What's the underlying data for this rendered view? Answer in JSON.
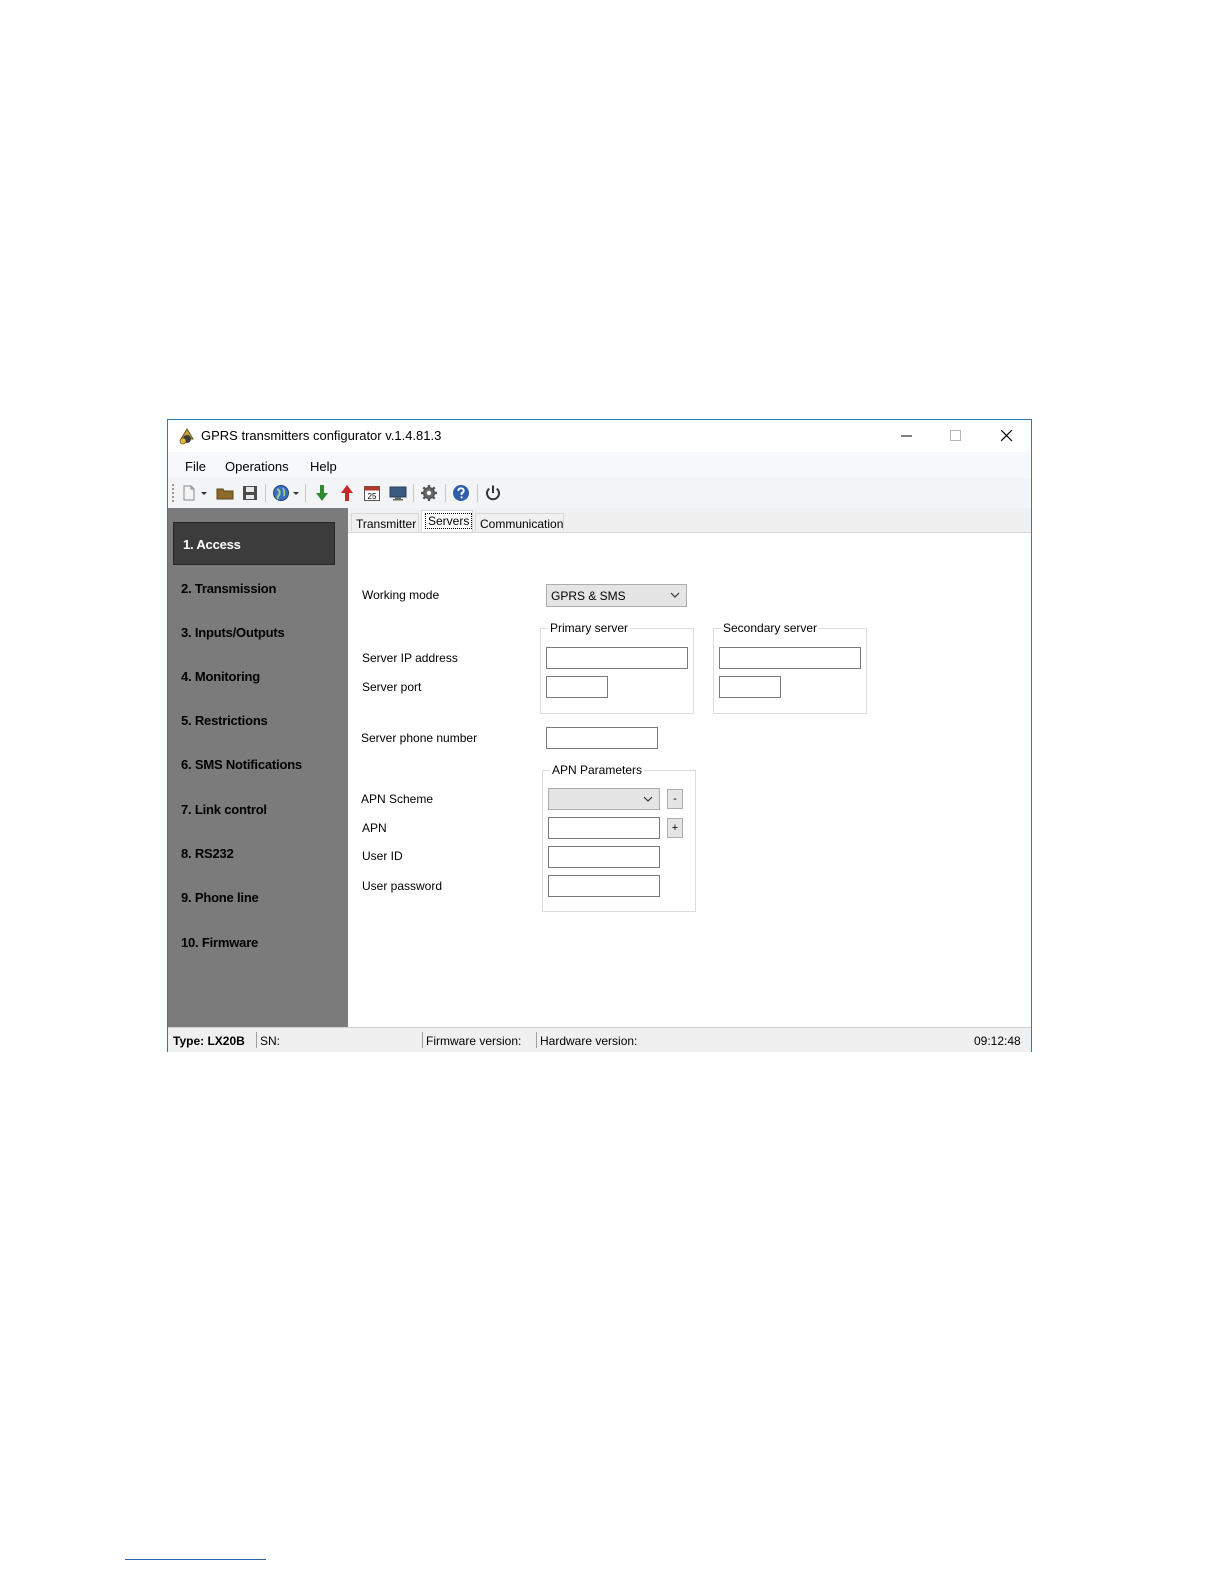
{
  "window": {
    "title": "GPRS transmitters configurator v.1.4.81.3"
  },
  "menu": [
    "File",
    "Operations",
    "Help"
  ],
  "toolbar_icons": [
    "new-file-icon",
    "open-folder-icon",
    "save-icon",
    "globe-icon",
    "download-arrow-icon",
    "upload-arrow-icon",
    "calendar-icon",
    "monitor-icon",
    "gear-icon",
    "help-icon",
    "power-icon"
  ],
  "toolbar_calendar_day": "25",
  "sidebar": {
    "items": [
      "1. Access",
      "2. Transmission",
      "3. Inputs/Outputs",
      "4. Monitoring",
      "5. Restrictions",
      "6. SMS Notifications",
      "7. Link control",
      "8. RS232",
      "9. Phone line",
      "10. Firmware"
    ],
    "active_index": 0
  },
  "tabs": [
    "Transmitter",
    "Servers",
    "Communication"
  ],
  "selected_tab": "Servers",
  "form": {
    "working_mode_label": "Working mode",
    "working_mode_value": "GPRS & SMS",
    "primary_server_title": "Primary server",
    "secondary_server_title": "Secondary server",
    "server_ip_label": "Server IP address",
    "server_port_label": "Server port",
    "primary_ip": "",
    "primary_port": "",
    "secondary_ip": "",
    "secondary_port": "",
    "server_phone_label": "Server phone number",
    "server_phone": "",
    "apn_group_title": "APN Parameters",
    "apn_scheme_label": "APN Scheme",
    "apn_scheme_value": "",
    "apn_label": "APN",
    "apn_value": "",
    "user_id_label": "User ID",
    "user_id_value": "",
    "user_password_label": "User password",
    "user_password_value": "",
    "remove_button": "-",
    "add_button": "+"
  },
  "status": {
    "type": "Type: LX20B",
    "sn": "SN:",
    "firmware": "Firmware version:",
    "hardware": "Hardware version:",
    "time": "09:12:48"
  },
  "colors": {
    "sidebar_bg": "#7b7b7b",
    "sidebar_active_bg": "#3c3c3c",
    "window_border": "#2b7bb9",
    "download_arrow": "#2e8b2e",
    "upload_arrow": "#c62828",
    "help_icon": "#2f5ea8"
  }
}
